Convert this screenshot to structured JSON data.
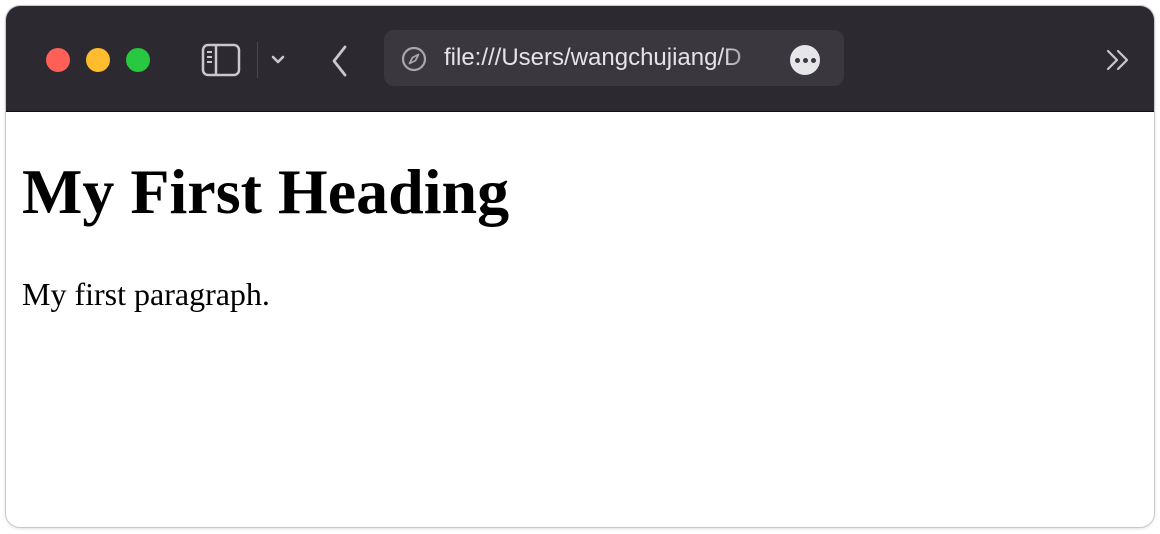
{
  "window": {
    "traffic_lights": {
      "close_color": "#fe5f57",
      "minimize_color": "#febc2e",
      "maximize_color": "#28c840"
    },
    "toolbar_color": "#2c2930"
  },
  "toolbar": {
    "sidebar_icon": "sidebar-icon",
    "tab_group_icon": "chevron-down-icon",
    "back_icon": "chevron-left-icon",
    "overflow_icon": "double-chevron-right-icon"
  },
  "address_bar": {
    "leading_icon": "compass-icon",
    "url": "file:///Users/wangchujiang/D",
    "trailing_icon": "more-icon"
  },
  "page": {
    "heading": "My First Heading",
    "paragraph": "My first paragraph."
  }
}
